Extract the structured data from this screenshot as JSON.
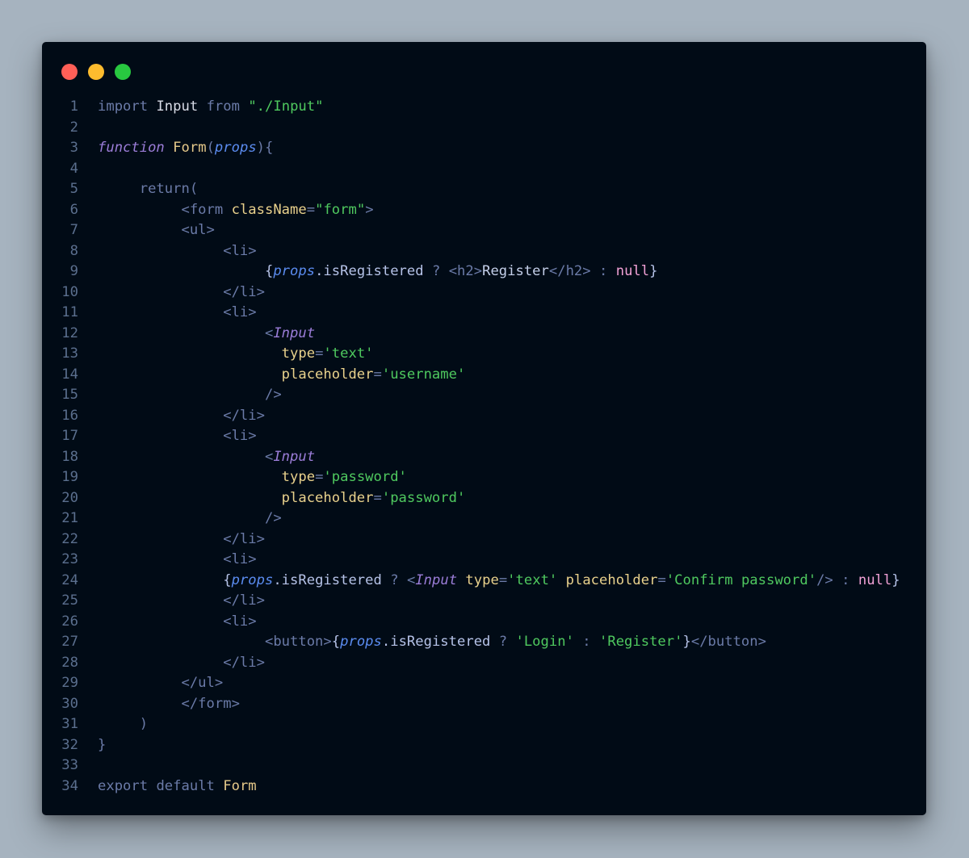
{
  "window": {
    "controls": [
      {
        "name": "close",
        "color": "#ff5f57"
      },
      {
        "name": "minimize",
        "color": "#febc2e"
      },
      {
        "name": "maximize",
        "color": "#28c840"
      }
    ]
  },
  "code": {
    "line_numbers": [
      "1",
      "2",
      "3",
      "4",
      "5",
      "6",
      "7",
      "8",
      "9",
      "10",
      "11",
      "12",
      "13",
      "14",
      "15",
      "16",
      "17",
      "18",
      "19",
      "20",
      "21",
      "22",
      "23",
      "24",
      "25",
      "26",
      "27",
      "28",
      "29",
      "30",
      "31",
      "32",
      "33",
      "34"
    ],
    "lines": [
      [
        [
          "kw",
          "import"
        ],
        [
          "t",
          " "
        ],
        [
          "cls",
          "Input"
        ],
        [
          "t",
          " "
        ],
        [
          "kw",
          "from"
        ],
        [
          "t",
          " "
        ],
        [
          "str",
          "\"./Input\""
        ]
      ],
      [],
      [
        [
          "kwf",
          "function"
        ],
        [
          "t",
          " "
        ],
        [
          "fn",
          "Form"
        ],
        [
          "pun",
          "("
        ],
        [
          "prm",
          "props"
        ],
        [
          "pun",
          "){"
        ]
      ],
      [],
      [
        [
          "t",
          "     "
        ],
        [
          "kw",
          "return"
        ],
        [
          "pun",
          "("
        ]
      ],
      [
        [
          "t",
          "          "
        ],
        [
          "tag",
          "<form"
        ],
        [
          "t",
          " "
        ],
        [
          "attr",
          "className"
        ],
        [
          "pun",
          "="
        ],
        [
          "str",
          "\"form\""
        ],
        [
          "tag",
          ">"
        ]
      ],
      [
        [
          "t",
          "          "
        ],
        [
          "tag",
          "<ul>"
        ]
      ],
      [
        [
          "t",
          "               "
        ],
        [
          "tag",
          "<li>"
        ]
      ],
      [
        [
          "t",
          "                    "
        ],
        [
          "brc",
          "{"
        ],
        [
          "prm",
          "props"
        ],
        [
          "prop",
          ".isRegistered"
        ],
        [
          "t",
          " "
        ],
        [
          "pun",
          "?"
        ],
        [
          "t",
          " "
        ],
        [
          "tag",
          "<h2>"
        ],
        [
          "txtc",
          "Register"
        ],
        [
          "tag",
          "</h2>"
        ],
        [
          "t",
          " "
        ],
        [
          "pun",
          ":"
        ],
        [
          "t",
          " "
        ],
        [
          "nul",
          "null"
        ],
        [
          "brc",
          "}"
        ]
      ],
      [
        [
          "t",
          "               "
        ],
        [
          "tag",
          "</li>"
        ]
      ],
      [
        [
          "t",
          "               "
        ],
        [
          "tag",
          "<li>"
        ]
      ],
      [
        [
          "t",
          "                    "
        ],
        [
          "tag",
          "<"
        ],
        [
          "comp",
          "Input"
        ]
      ],
      [
        [
          "t",
          "                      "
        ],
        [
          "attr",
          "type"
        ],
        [
          "pun",
          "="
        ],
        [
          "str",
          "'text'"
        ]
      ],
      [
        [
          "t",
          "                      "
        ],
        [
          "attr",
          "placeholder"
        ],
        [
          "pun",
          "="
        ],
        [
          "str",
          "'username'"
        ]
      ],
      [
        [
          "t",
          "                    "
        ],
        [
          "tag",
          "/>"
        ]
      ],
      [
        [
          "t",
          "               "
        ],
        [
          "tag",
          "</li>"
        ]
      ],
      [
        [
          "t",
          "               "
        ],
        [
          "tag",
          "<li>"
        ]
      ],
      [
        [
          "t",
          "                    "
        ],
        [
          "tag",
          "<"
        ],
        [
          "comp",
          "Input"
        ]
      ],
      [
        [
          "t",
          "                      "
        ],
        [
          "attr",
          "type"
        ],
        [
          "pun",
          "="
        ],
        [
          "str",
          "'password'"
        ]
      ],
      [
        [
          "t",
          "                      "
        ],
        [
          "attr",
          "placeholder"
        ],
        [
          "pun",
          "="
        ],
        [
          "str",
          "'password'"
        ]
      ],
      [
        [
          "t",
          "                    "
        ],
        [
          "tag",
          "/>"
        ]
      ],
      [
        [
          "t",
          "               "
        ],
        [
          "tag",
          "</li>"
        ]
      ],
      [
        [
          "t",
          "               "
        ],
        [
          "tag",
          "<li>"
        ]
      ],
      [
        [
          "t",
          "               "
        ],
        [
          "brc",
          "{"
        ],
        [
          "prm",
          "props"
        ],
        [
          "prop",
          ".isRegistered"
        ],
        [
          "t",
          " "
        ],
        [
          "pun",
          "?"
        ],
        [
          "t",
          " "
        ],
        [
          "tag",
          "<"
        ],
        [
          "comp",
          "Input"
        ],
        [
          "t",
          " "
        ],
        [
          "attr",
          "type"
        ],
        [
          "pun",
          "="
        ],
        [
          "str",
          "'text'"
        ],
        [
          "t",
          " "
        ],
        [
          "attr",
          "placeholder"
        ],
        [
          "pun",
          "="
        ],
        [
          "str",
          "'Confirm password'"
        ],
        [
          "tag",
          "/>"
        ],
        [
          "t",
          " "
        ],
        [
          "pun",
          ":"
        ],
        [
          "t",
          " "
        ],
        [
          "nul",
          "null"
        ],
        [
          "brc",
          "}"
        ]
      ],
      [
        [
          "t",
          "               "
        ],
        [
          "tag",
          "</li>"
        ]
      ],
      [
        [
          "t",
          "               "
        ],
        [
          "tag",
          "<li>"
        ]
      ],
      [
        [
          "t",
          "                    "
        ],
        [
          "tag",
          "<button>"
        ],
        [
          "brc",
          "{"
        ],
        [
          "prm",
          "props"
        ],
        [
          "prop",
          ".isRegistered"
        ],
        [
          "t",
          " "
        ],
        [
          "pun",
          "?"
        ],
        [
          "t",
          " "
        ],
        [
          "str",
          "'Login'"
        ],
        [
          "t",
          " "
        ],
        [
          "pun",
          ":"
        ],
        [
          "t",
          " "
        ],
        [
          "str",
          "'Register'"
        ],
        [
          "brc",
          "}"
        ],
        [
          "tag",
          "</button>"
        ]
      ],
      [
        [
          "t",
          "               "
        ],
        [
          "tag",
          "</li>"
        ]
      ],
      [
        [
          "t",
          "          "
        ],
        [
          "tag",
          "</ul>"
        ]
      ],
      [
        [
          "t",
          "          "
        ],
        [
          "tag",
          "</form>"
        ]
      ],
      [
        [
          "t",
          "     "
        ],
        [
          "pun",
          ")"
        ]
      ],
      [
        [
          "pun",
          "}"
        ]
      ],
      [],
      [
        [
          "kw",
          "export"
        ],
        [
          "t",
          " "
        ],
        [
          "kw",
          "default"
        ],
        [
          "t",
          " "
        ],
        [
          "fn",
          "Form"
        ]
      ]
    ]
  }
}
